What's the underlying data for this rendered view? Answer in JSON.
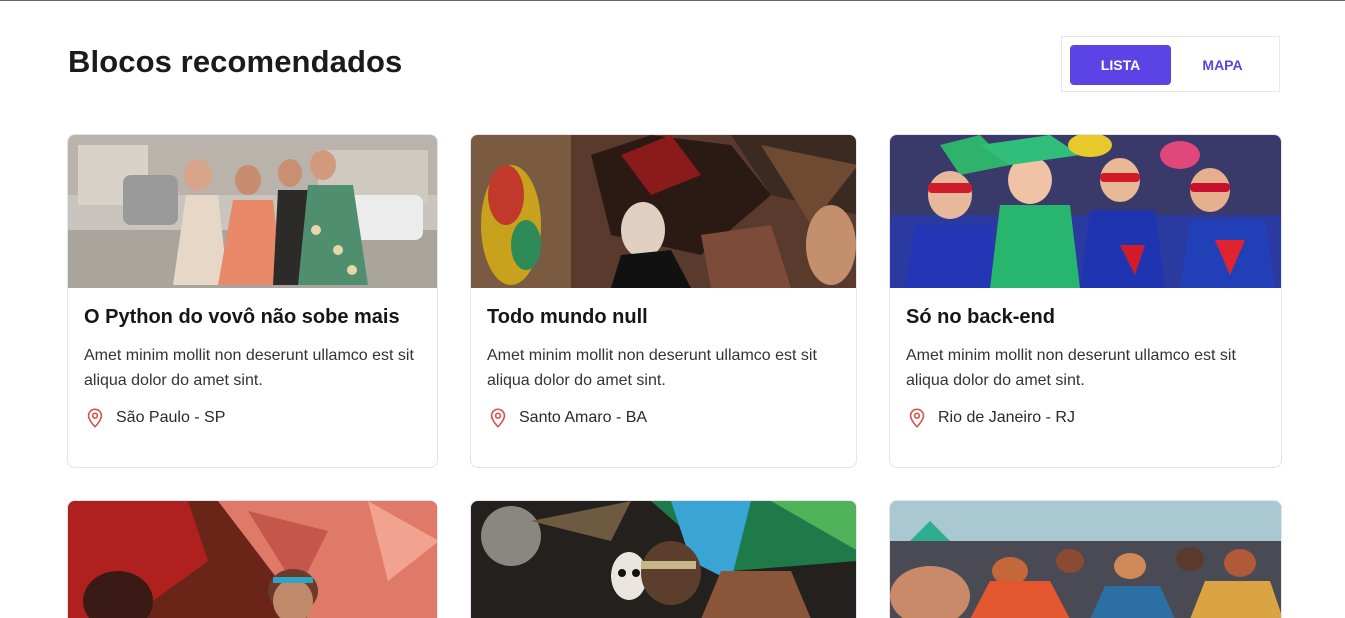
{
  "page": {
    "title": "Blocos recomendados"
  },
  "view_toggle": {
    "list_label": "LISTA",
    "map_label": "MAPA",
    "active": "LISTA"
  },
  "colors": {
    "accent": "#5c43e6",
    "pin": "#d9534f"
  },
  "cards": [
    {
      "title": "O Python do vovô não sobe mais",
      "description": "Amet minim mollit non deserunt ullamco est sit aliqua dolor do amet sint.",
      "location": "São Paulo - SP",
      "location_icon": "map-pin-icon"
    },
    {
      "title": "Todo mundo null",
      "description": "Amet minim mollit non deserunt ullamco est sit aliqua dolor do amet sint.",
      "location": "Santo Amaro - BA",
      "location_icon": "map-pin-icon"
    },
    {
      "title": "Só no back-end",
      "description": "Amet minim mollit non deserunt ullamco est sit aliqua dolor do amet sint.",
      "location": "Rio de Janeiro - RJ",
      "location_icon": "map-pin-icon"
    },
    {
      "title": "",
      "description": "",
      "location": ""
    },
    {
      "title": "",
      "description": "",
      "location": ""
    },
    {
      "title": "",
      "description": "",
      "location": ""
    }
  ]
}
